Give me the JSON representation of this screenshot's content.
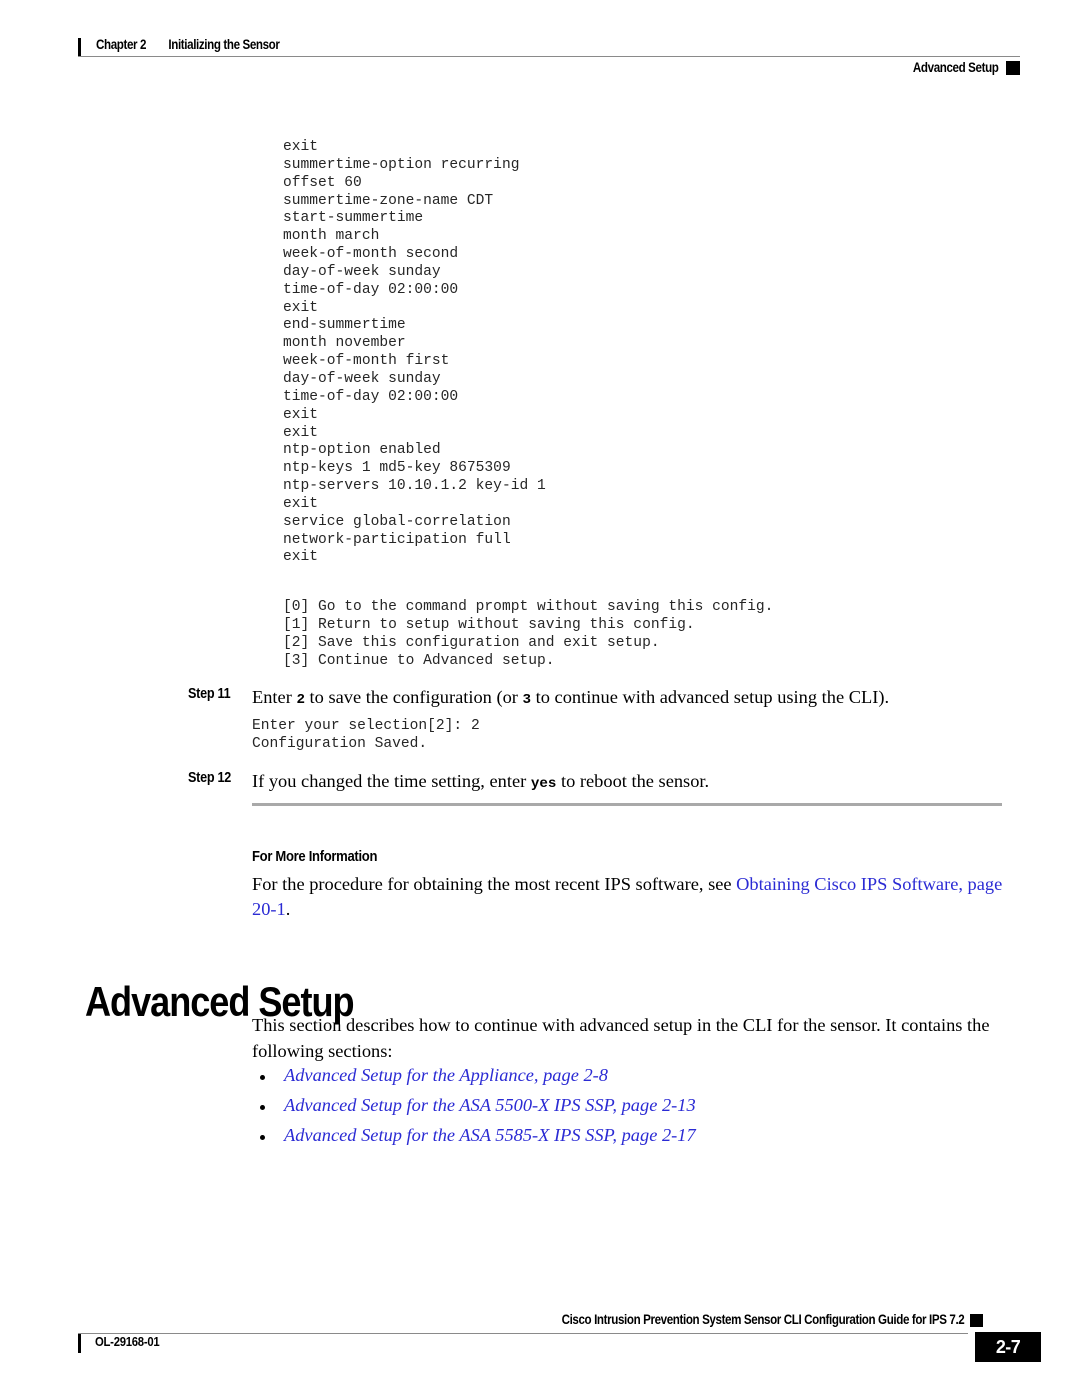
{
  "header": {
    "chapter": "Chapter 2",
    "chapter_title": "Initializing the Sensor",
    "section": "Advanced Setup"
  },
  "code_block_1": "exit\nsummertime-option recurring\noffset 60\nsummertime-zone-name CDT\nstart-summertime\nmonth march\nweek-of-month second\nday-of-week sunday\ntime-of-day 02:00:00\nexit\nend-summertime\nmonth november\nweek-of-month first\nday-of-week sunday\ntime-of-day 02:00:00\nexit\nexit\nntp-option enabled\nntp-keys 1 md5-key 8675309\nntp-servers 10.10.1.2 key-id 1\nexit\nservice global-correlation\nnetwork-participation full\nexit",
  "code_block_2": "[0] Go to the command prompt without saving this config.\n[1] Return to setup without saving this config.\n[2] Save this configuration and exit setup.\n[3] Continue to Advanced setup.",
  "code_block_3": "Enter your selection[2]: 2\nConfiguration Saved.",
  "steps": [
    {
      "label": "Step 11",
      "text_1": "Enter ",
      "code_1": "2",
      "text_2": " to save the configuration (or ",
      "code_2": "3",
      "text_3": " to continue with advanced setup using the CLI)."
    },
    {
      "label": "Step 12",
      "text_1": "If you changed the time setting, enter ",
      "code_1": "yes",
      "text_2": " to reboot the sensor."
    }
  ],
  "for_more_information": {
    "heading": "For More Information",
    "para_text": "For the procedure for obtaining the most recent IPS software, see ",
    "link_text": "Obtaining Cisco IPS Software, page 20-1",
    "para_end": "."
  },
  "section": {
    "title": "Advanced Setup",
    "intro": "This section describes how to continue with advanced setup in the CLI for the sensor. It contains the following sections:",
    "links": [
      "Advanced Setup for the Appliance, page 2-8",
      "Advanced Setup for the ASA 5500-X IPS SSP, page 2-13",
      "Advanced Setup for the ASA 5585-X IPS SSP, page 2-17"
    ]
  },
  "footer": {
    "doc_id": "OL-29168-01",
    "guide_title": "Cisco Intrusion Prevention System Sensor CLI Configuration Guide for IPS 7.2",
    "page_number": "2-7"
  },
  "colors": {
    "link_blue": "#2b2bd4",
    "rule_gray": "#a9a9a9",
    "code_gray": "#262626"
  }
}
